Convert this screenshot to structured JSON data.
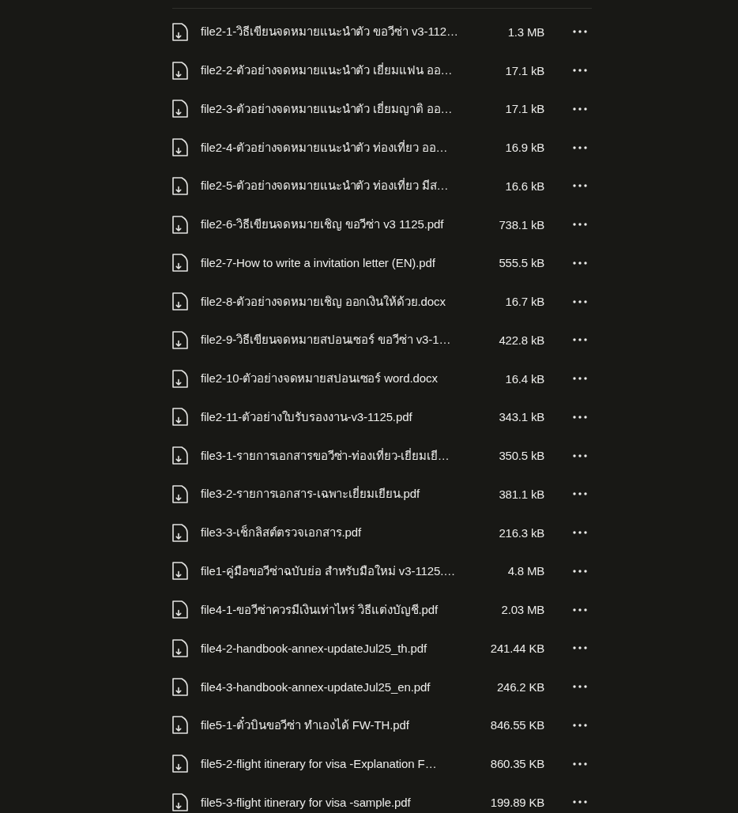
{
  "files": [
    {
      "name": "file2-1-วิธีเขียนจดหมายแนะนำตัว ขอวีซ่า v3-112…",
      "size": "1.3 MB"
    },
    {
      "name": "file2-2-ตัวอย่างจดหมายแนะนำตัว เยี่ยมแฟน ออ…",
      "size": "17.1 kB"
    },
    {
      "name": "file2-3-ตัวอย่างจดหมายแนะนำตัว เยี่ยมญาติ ออ…",
      "size": "17.1 kB"
    },
    {
      "name": "file2-4-ตัวอย่างจดหมายแนะนำตัว ท่องเที่ยว ออ…",
      "size": "16.9 kB"
    },
    {
      "name": "file2-5-ตัวอย่างจดหมายแนะนำตัว ท่องเที่ยว มีส…",
      "size": "16.6 kB"
    },
    {
      "name": "file2-6-วิธีเขียนจดหมายเชิญ ขอวีซ่า v3 1125.pdf",
      "size": "738.1 kB"
    },
    {
      "name": "file2-7-How to write a invitation letter (EN).pdf",
      "size": "555.5 kB"
    },
    {
      "name": "file2-8-ตัวอย่างจดหมายเชิญ ออกเงินให้ด้วย.docx",
      "size": "16.7 kB"
    },
    {
      "name": "file2-9-วิธีเขียนจดหมายสปอนเซอร์ ขอวีซ่า v3-1…",
      "size": "422.8 kB"
    },
    {
      "name": "file2-10-ตัวอย่างจดหมายสปอนเซอร์ word.docx",
      "size": "16.4 kB"
    },
    {
      "name": "file2-11-ตัวอย่างใบรับรองงาน-v3-1125.pdf",
      "size": "343.1 kB"
    },
    {
      "name": "file3-1-รายการเอกสารขอวีซ่า-ท่องเที่ยว-เยี่ยมเยี…",
      "size": "350.5 kB"
    },
    {
      "name": "file3-2-รายการเอกสาร-เฉพาะเยี่ยมเยียน.pdf",
      "size": "381.1 kB"
    },
    {
      "name": "file3-3-เช็กลิสต์ตรวจเอกสาร.pdf",
      "size": "216.3 kB"
    },
    {
      "name": "file1-คู่มือขอวีซ่าฉบับย่อ สำหรับมือใหม่ v3-1125.…",
      "size": "4.8 MB"
    },
    {
      "name": "file4-1-ขอวีซ่าควรมีเงินเท่าไหร่ วิธีแต่งบัญชี.pdf",
      "size": "2.03 MB"
    },
    {
      "name": "file4-2-handbook-annex-updateJul25_th.pdf",
      "size": "241.44 KB"
    },
    {
      "name": "file4-3-handbook-annex-updateJul25_en.pdf",
      "size": "246.2 KB"
    },
    {
      "name": "file5-1-ตั๋วบินขอวีซ่า ทำเองได้ FW-TH.pdf",
      "size": "846.55 KB"
    },
    {
      "name": "file5-2-flight itinerary for visa -Explanation F…",
      "size": "860.35 KB"
    },
    {
      "name": "file5-3-flight itinerary for visa -sample.pdf",
      "size": "199.89 KB"
    }
  ]
}
